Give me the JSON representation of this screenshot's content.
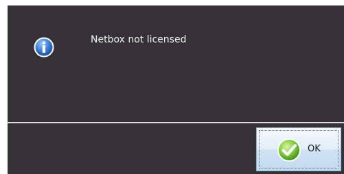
{
  "dialog": {
    "message": "Netbox not licensed",
    "icon": "info-icon",
    "background_color": "#343235"
  },
  "footer": {
    "ok_button": {
      "label": "OK",
      "icon": "check-icon"
    }
  }
}
